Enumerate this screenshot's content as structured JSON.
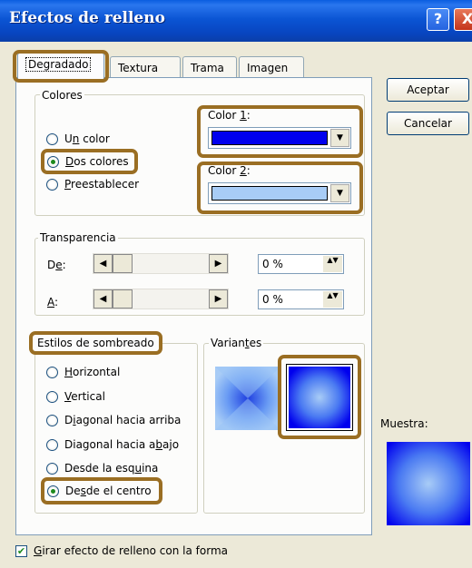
{
  "window": {
    "title": "Efectos de relleno",
    "help_glyph": "?",
    "close_glyph": "X"
  },
  "tabs": [
    {
      "label": "Degradado",
      "active": true
    },
    {
      "label": "Textura",
      "active": false
    },
    {
      "label": "Trama",
      "active": false
    },
    {
      "label": "Imagen",
      "active": false
    }
  ],
  "buttons": {
    "accept": "Aceptar",
    "cancel": "Cancelar"
  },
  "colors_group": {
    "title": "Colores",
    "options": [
      {
        "pre": "U",
        "key": "n",
        "post": " color",
        "selected": false
      },
      {
        "pre": "",
        "key": "D",
        "post": "os colores",
        "selected": true
      },
      {
        "pre": "",
        "key": "P",
        "post": "reestablecer",
        "selected": false
      }
    ],
    "color1": {
      "pre": "Color ",
      "key": "1",
      "post": ":",
      "value": "#0000ee"
    },
    "color2": {
      "pre": "Color ",
      "key": "2",
      "post": ":",
      "value": "#a8ccf6"
    }
  },
  "transparency": {
    "title": "Transparencia",
    "from": {
      "pre": "D",
      "key": "e",
      "post": ":",
      "value": "0 %",
      "level": 0
    },
    "to": {
      "pre": "",
      "key": "A",
      "post": ":",
      "value": "0 %",
      "level": 0
    }
  },
  "shading": {
    "title": "Estilos de sombreado",
    "options": [
      {
        "pre": "",
        "key": "H",
        "post": "orizontal",
        "selected": false
      },
      {
        "pre": "",
        "key": "V",
        "post": "ertical",
        "selected": false
      },
      {
        "pre": "D",
        "key": "i",
        "post": "agonal hacia arriba",
        "selected": false
      },
      {
        "pre": "Diagonal hacia a",
        "key": "b",
        "post": "ajo",
        "selected": false
      },
      {
        "pre": "Desde la esq",
        "key": "u",
        "post": "ina",
        "selected": false
      },
      {
        "pre": "De",
        "key": "s",
        "post": "de el centro",
        "selected": true
      }
    ]
  },
  "variants": {
    "title_pre": "Varian",
    "title_key": "t",
    "title_post": "es",
    "selected_index": 1
  },
  "sample": {
    "label": "Muestra:"
  },
  "rotate": {
    "pre": "",
    "key": "G",
    "post": "irar efecto de relleno con la forma",
    "checked": true,
    "check_glyph": "✔"
  },
  "glyphs": {
    "dropdown": "▼",
    "left": "◀",
    "right": "▶",
    "spin": "▲▼"
  }
}
